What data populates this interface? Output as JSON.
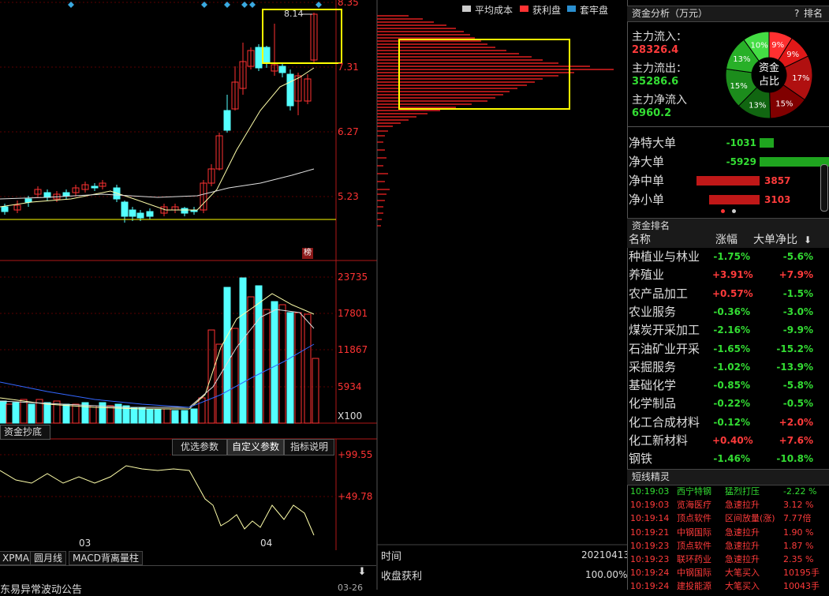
{
  "main_chart": {
    "price_ticks": [
      "8.35",
      "7.31",
      "6.27",
      "5.23"
    ],
    "high_label": "8.14",
    "bang_label": "榜",
    "colors": {
      "up": "#ff3232",
      "down": "#54ffff",
      "ma_short": "#ffffaa",
      "ma_mid": "#e0e0e0",
      "ma_long": "#ffff00",
      "box": "#ffff00"
    }
  },
  "volume_chart": {
    "ticks": [
      "23735",
      "17801",
      "11867",
      "5934"
    ],
    "unit": "X100"
  },
  "indicator": {
    "panel_label": "资金抄底",
    "tabs": [
      "优选参数",
      "自定义参数",
      "指标说明"
    ],
    "active_tab": 1,
    "ticks": [
      "+99.55",
      "+49.78"
    ],
    "x_labels": [
      "03",
      "04"
    ]
  },
  "bottom_tabs": [
    "XPMA",
    "圆月线",
    "MACD背离量柱"
  ],
  "bottom_ticker": {
    "text": "东易异常波动公告",
    "right": "03-26"
  },
  "chip_panel": {
    "legend": [
      "平均成本",
      "获利盘",
      "套牢盘"
    ],
    "time_label": "时间",
    "time_value": "20210413",
    "profit_label": "收盘获利",
    "profit_value": "100.00%"
  },
  "fund_analysis": {
    "title": "资金分析（万元）",
    "help": "?",
    "rank_btn": "排名",
    "inflow_label": "主力流入：",
    "inflow_value": "28326.4",
    "outflow_label": "主力流出：",
    "outflow_value": "35286.6",
    "net_label": "主力净流入",
    "net_value": "6960.2",
    "donut_center": [
      "资金",
      "占比"
    ],
    "donut": [
      {
        "label": "9%",
        "value": 9,
        "color": "#ff3030"
      },
      {
        "label": "9%",
        "value": 9,
        "color": "#e01818"
      },
      {
        "label": "17%",
        "value": 17,
        "color": "#b01010"
      },
      {
        "label": "15%",
        "value": 15,
        "color": "#800000"
      },
      {
        "label": "13%",
        "value": 13,
        "color": "#116611"
      },
      {
        "label": "15%",
        "value": 15,
        "color": "#1c8c1c"
      },
      {
        "label": "13%",
        "value": 13,
        "color": "#28b028"
      },
      {
        "label": "10%",
        "value": 10,
        "color": "#44dd44"
      }
    ]
  },
  "net_flows": [
    {
      "label": "净特大单",
      "value": "-1031",
      "color": "#1fa51f",
      "sign": "neg",
      "bar": 0.09
    },
    {
      "label": "净大单",
      "value": "-5929",
      "color": "#1fa51f",
      "sign": "neg",
      "bar": 0.62
    },
    {
      "label": "净中单",
      "value": "3857",
      "color": "#c01818",
      "sign": "pos",
      "bar": 0.4
    },
    {
      "label": "净小单",
      "value": "3103",
      "color": "#c01818",
      "sign": "pos",
      "bar": 0.32
    }
  ],
  "ranking": {
    "title": "资金排名",
    "headers": [
      "名称",
      "涨幅",
      "大单净比"
    ],
    "rows": [
      {
        "name": "种植业与林业",
        "chg": "-1.75%",
        "ratio": "-5.6%"
      },
      {
        "name": "养殖业",
        "chg": "+3.91%",
        "ratio": "+7.9%"
      },
      {
        "name": "农产品加工",
        "chg": "+0.57%",
        "ratio": "-1.5%"
      },
      {
        "name": "农业服务",
        "chg": "-0.36%",
        "ratio": "-3.0%"
      },
      {
        "name": "煤炭开采加工",
        "chg": "-2.16%",
        "ratio": "-9.9%"
      },
      {
        "name": "石油矿业开采",
        "chg": "-1.65%",
        "ratio": "-15.2%"
      },
      {
        "name": "采掘服务",
        "chg": "-1.02%",
        "ratio": "-13.9%"
      },
      {
        "name": "基础化学",
        "chg": "-0.85%",
        "ratio": "-5.8%"
      },
      {
        "name": "化学制品",
        "chg": "-0.22%",
        "ratio": "-0.5%"
      },
      {
        "name": "化工合成材料",
        "chg": "-0.12%",
        "ratio": "+2.0%"
      },
      {
        "name": "化工新材料",
        "chg": "+0.40%",
        "ratio": "+7.6%"
      },
      {
        "name": "钢铁",
        "chg": "-1.46%",
        "ratio": "-10.8%"
      }
    ]
  },
  "short_line": {
    "title": "短线精灵",
    "rows": [
      {
        "time": "10:19:03",
        "name": "西宁特钢",
        "event": "猛烈打压",
        "val": "-2.22 %",
        "dir": "dn"
      },
      {
        "time": "10:19:03",
        "name": "览海医疗",
        "event": "急速拉升",
        "val": "3.12 %",
        "dir": "up"
      },
      {
        "time": "10:19:14",
        "name": "顶点软件",
        "event": "区间放量(涨)",
        "val": "7.77倍",
        "dir": "up"
      },
      {
        "time": "10:19:21",
        "name": "中钢国际",
        "event": "急速拉升",
        "val": "1.90 %",
        "dir": "up"
      },
      {
        "time": "10:19:23",
        "name": "顶点软件",
        "event": "急速拉升",
        "val": "1.87 %",
        "dir": "up"
      },
      {
        "time": "10:19:23",
        "name": "联环药业",
        "event": "急速拉升",
        "val": "2.35 %",
        "dir": "up"
      },
      {
        "time": "10:19:24",
        "name": "中钢国际",
        "event": "大笔买入",
        "val": "10195手",
        "dir": "up"
      },
      {
        "time": "10:19:24",
        "name": "建投能源",
        "event": "大笔买入",
        "val": "10043手",
        "dir": "up"
      }
    ]
  }
}
